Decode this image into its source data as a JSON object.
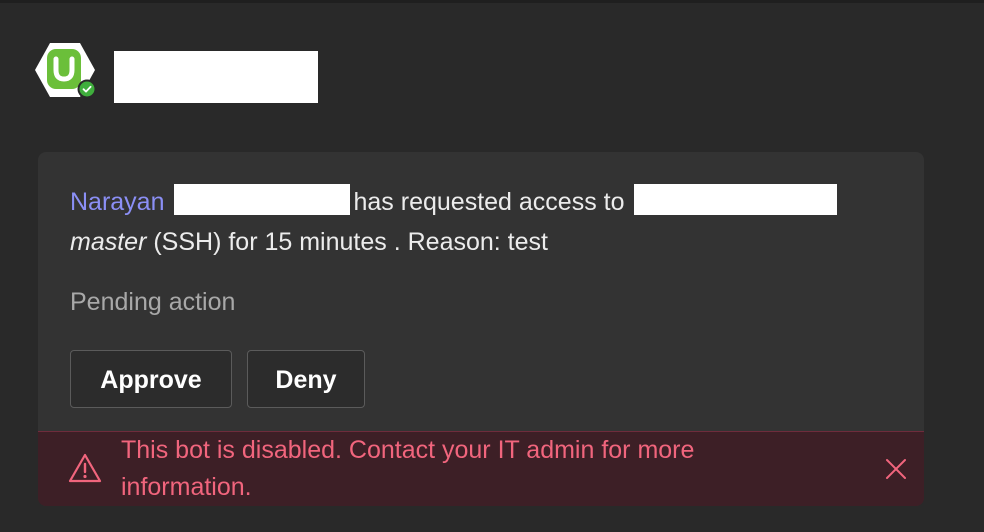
{
  "sender": {
    "avatar_icon": "bot-avatar-icon",
    "status_icon": "online-check-icon",
    "accent_color": "#6bbf3a"
  },
  "card": {
    "message": {
      "requester": "Narayan",
      "text_1": "has requested access to",
      "resource": "master",
      "text_2": "(SSH) for 15 minutes . Reason: test"
    },
    "status": "Pending action",
    "buttons": {
      "approve": "Approve",
      "deny": "Deny"
    },
    "banner": {
      "text": "This bot is disabled. Contact your IT admin for more information.",
      "icon": "warning-icon",
      "close_icon": "close-icon",
      "color": "#f1657d"
    }
  }
}
